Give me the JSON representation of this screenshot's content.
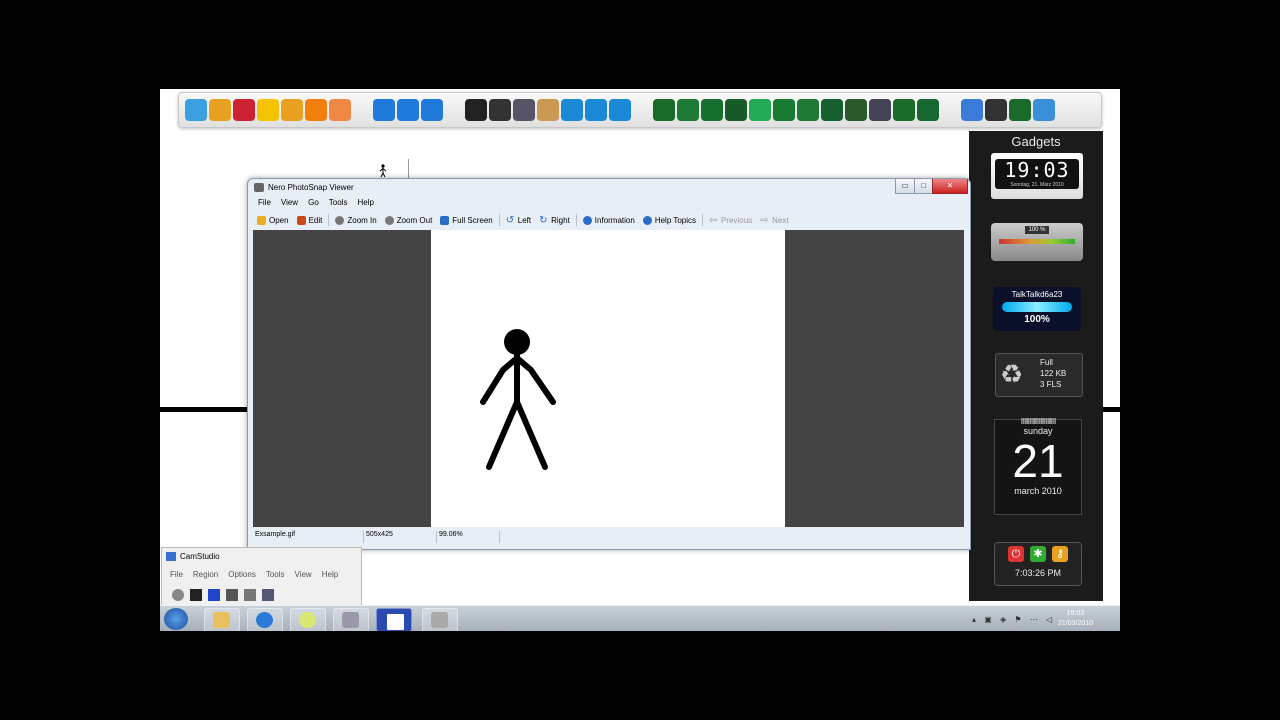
{
  "dock": {
    "icons": [
      "paint-icon",
      "tools-icon",
      "rocket-icon",
      "cube-icon",
      "joystick-icon",
      "vlc-cone-icon",
      "media-player-icon",
      "ie-icon",
      "folder-icon",
      "network-icon",
      "hat-icon",
      "hat-icon",
      "film-reel-icon",
      "chart-icon",
      "e-icon",
      "e-icon",
      "e-icon",
      "green-globe-icon",
      "green-hat-icon",
      "green-film-icon",
      "green-globe-icon",
      "green-globe-icon",
      "green-clock-icon",
      "green-hat-icon",
      "green-window-icon",
      "green-gear-icon",
      "tools-icon",
      "green-globe-icon",
      "green-window-icon",
      "grid-icon",
      "eye-icon",
      "gear-globe-icon",
      "settings-icon"
    ],
    "colors": [
      "#3aa0e0",
      "#e8a020",
      "#c23",
      "#f4c400",
      "#e8a020",
      "#f27f0c",
      "#e84",
      "#1f7ad9",
      "#1f7ad9",
      "#1f7ad9",
      "#222",
      "#333",
      "#556",
      "#c95",
      "#1a8ad6",
      "#1a8ad6",
      "#1a8ad6",
      "#1a6a2a",
      "#1e7a34",
      "#157030",
      "#185a28",
      "#2a5",
      "#187a30",
      "#1e7a34",
      "#166030",
      "#2a5a2a",
      "#445",
      "#1a6a2a",
      "#176830",
      "#3a7ad8",
      "#333",
      "#1a6a2a",
      "#3a90d8"
    ]
  },
  "gadgets": {
    "title": "Gadgets",
    "clock": {
      "time": "19:03",
      "date": "Sonntag, 21. März 2010"
    },
    "meter": {
      "percent": "100 %"
    },
    "wifi": {
      "name": "TalkTalkd6a23",
      "signal": "100%"
    },
    "recycle": {
      "status": "Full",
      "size": "122 KB",
      "files": "3 FLS"
    },
    "calendar": {
      "day": "sunday",
      "date": "21",
      "month": "march 2010"
    },
    "system": {
      "time": "7:03:26 PM",
      "buttons": [
        "power-icon",
        "restart-icon",
        "lock-icon"
      ]
    }
  },
  "viewer": {
    "title": "Nero PhotoSnap Viewer",
    "menu": [
      "File",
      "View",
      "Go",
      "Tools",
      "Help"
    ],
    "toolbar": {
      "open": "Open",
      "edit": "Edit",
      "zoom_in": "Zoom In",
      "zoom_out": "Zoom Out",
      "full_screen": "Full Screen",
      "left": "Left",
      "right": "Right",
      "information": "Information",
      "help_topics": "Help Topics",
      "previous": "Previous",
      "next": "Next"
    },
    "status": {
      "file": "Exsample.gif",
      "dims": "505x425",
      "zoom": "99.06%"
    }
  },
  "camstudio": {
    "title": "CamStudio",
    "menu": [
      "File",
      "Region",
      "Options",
      "Tools",
      "View",
      "Help"
    ]
  },
  "taskbar": {
    "time": "19:03",
    "date": "21/03/2010"
  }
}
